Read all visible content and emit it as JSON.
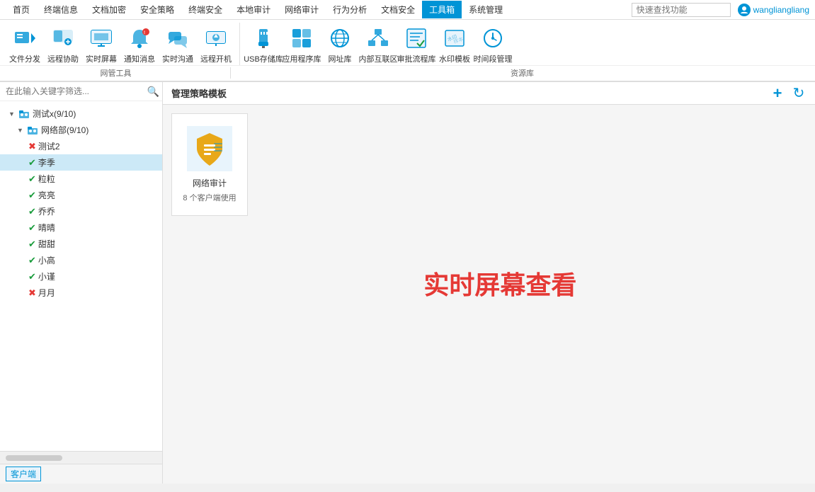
{
  "topnav": {
    "items": [
      "首页",
      "终端信息",
      "文档加密",
      "安全策略",
      "终端安全",
      "本地审计",
      "网络审计",
      "行为分析",
      "文档安全",
      "工具箱",
      "系统管理"
    ],
    "active": "工具箱",
    "search_placeholder": "快速查找功能",
    "username": "wangliangliang"
  },
  "toolbar": {
    "group1": {
      "label": "网管工具",
      "items": [
        {
          "id": "file-dist",
          "label": "文件分发",
          "icon": "file"
        },
        {
          "id": "remote-assist",
          "label": "远程协助",
          "icon": "remote"
        },
        {
          "id": "realtime-screen",
          "label": "实时屏幕",
          "icon": "screen"
        },
        {
          "id": "notify-msg",
          "label": "通知消息",
          "icon": "bell"
        },
        {
          "id": "realtime-comm",
          "label": "实时沟通",
          "icon": "chat"
        },
        {
          "id": "remote-boot",
          "label": "远程开机",
          "icon": "power"
        }
      ]
    },
    "group2": {
      "label": "资源库",
      "items": [
        {
          "id": "usb-storage",
          "label": "USB存储库",
          "icon": "usb"
        },
        {
          "id": "app-repo",
          "label": "应用程序库",
          "icon": "app"
        },
        {
          "id": "url-lib",
          "label": "网址库",
          "icon": "globe"
        },
        {
          "id": "internal-net",
          "label": "内部互联区",
          "icon": "network"
        },
        {
          "id": "approval-flow",
          "label": "审批流程库",
          "icon": "flow"
        },
        {
          "id": "watermark",
          "label": "水印模板",
          "icon": "watermark"
        },
        {
          "id": "time-manage",
          "label": "时间段管理",
          "icon": "time"
        }
      ]
    }
  },
  "sidebar": {
    "search_placeholder": "在此输入关键字筛选...",
    "tree": [
      {
        "id": "root",
        "label": "测试x(9/10)",
        "level": 0,
        "type": "group",
        "arrow": "▼",
        "status": ""
      },
      {
        "id": "net",
        "label": "网络部(9/10)",
        "level": 1,
        "type": "group",
        "arrow": "▼",
        "status": ""
      },
      {
        "id": "test2",
        "label": "测试2",
        "level": 2,
        "type": "node",
        "status": "err"
      },
      {
        "id": "liji",
        "label": "李季",
        "level": 2,
        "type": "node",
        "status": "ok"
      },
      {
        "id": "lili",
        "label": "粒粒",
        "level": 2,
        "type": "node",
        "status": "ok"
      },
      {
        "id": "liangx",
        "label": "亮亮",
        "level": 2,
        "type": "node",
        "status": "ok"
      },
      {
        "id": "qiaoq",
        "label": "乔乔",
        "level": 2,
        "type": "node",
        "status": "ok"
      },
      {
        "id": "jingj",
        "label": "晴晴",
        "level": 2,
        "type": "node",
        "status": "ok"
      },
      {
        "id": "tiant",
        "label": "甜甜",
        "level": 2,
        "type": "node",
        "status": "ok"
      },
      {
        "id": "xiaog",
        "label": "小高",
        "level": 2,
        "type": "node",
        "status": "ok"
      },
      {
        "id": "xiaot",
        "label": "小谨",
        "level": 2,
        "type": "node",
        "status": "ok"
      },
      {
        "id": "yuey",
        "label": "月月",
        "level": 2,
        "type": "node",
        "status": "err2"
      }
    ],
    "bottom_tab": "客户端"
  },
  "main": {
    "title": "管理策略模板",
    "add_btn": "+",
    "refresh_btn": "↻",
    "cards": [
      {
        "id": "net-audit",
        "name": "网络审计",
        "count": "8 个客户端使用",
        "icon": "audit"
      }
    ],
    "big_text": "实时屏幕查看"
  }
}
